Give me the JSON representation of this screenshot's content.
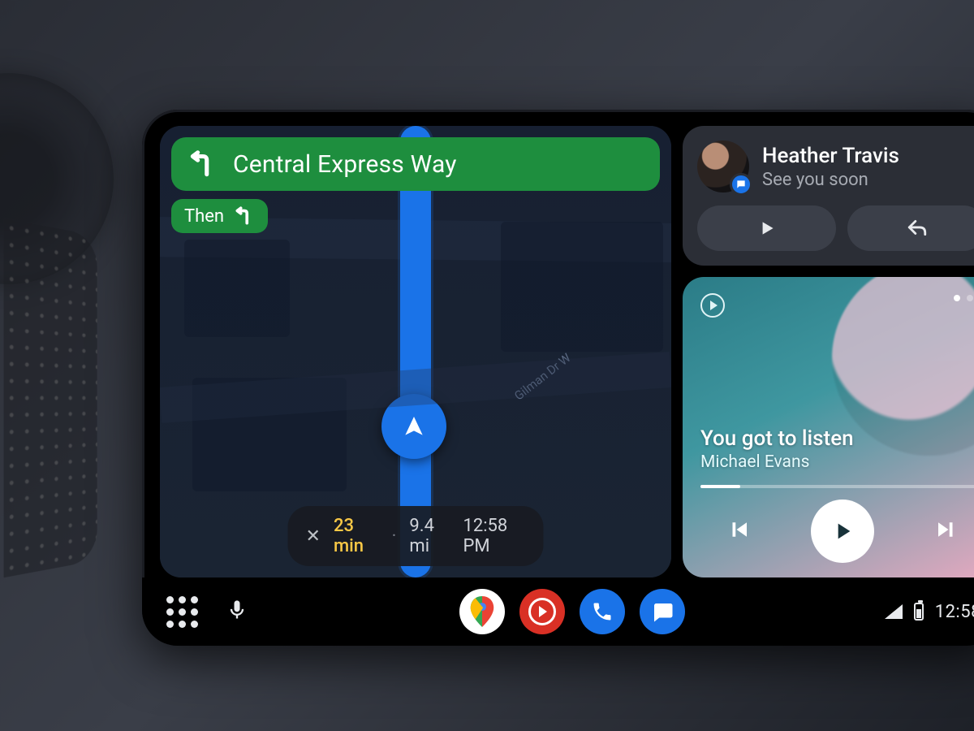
{
  "nav": {
    "road": "Central Express Way",
    "then_label": "Then",
    "eta_duration": "23 min",
    "eta_distance": "9.4 mi",
    "eta_arrival": "12:58 PM",
    "street_label": "Gilman Dr W"
  },
  "message": {
    "sender": "Heather Travis",
    "body": "See you soon"
  },
  "media": {
    "track": "You got to listen",
    "artist": "Michael Evans",
    "progress_pct": 14
  },
  "status": {
    "time": "12:58"
  },
  "colors": {
    "nav_green": "#1e8e3e",
    "blue": "#1a73e8",
    "eta_time": "#f9c846"
  }
}
